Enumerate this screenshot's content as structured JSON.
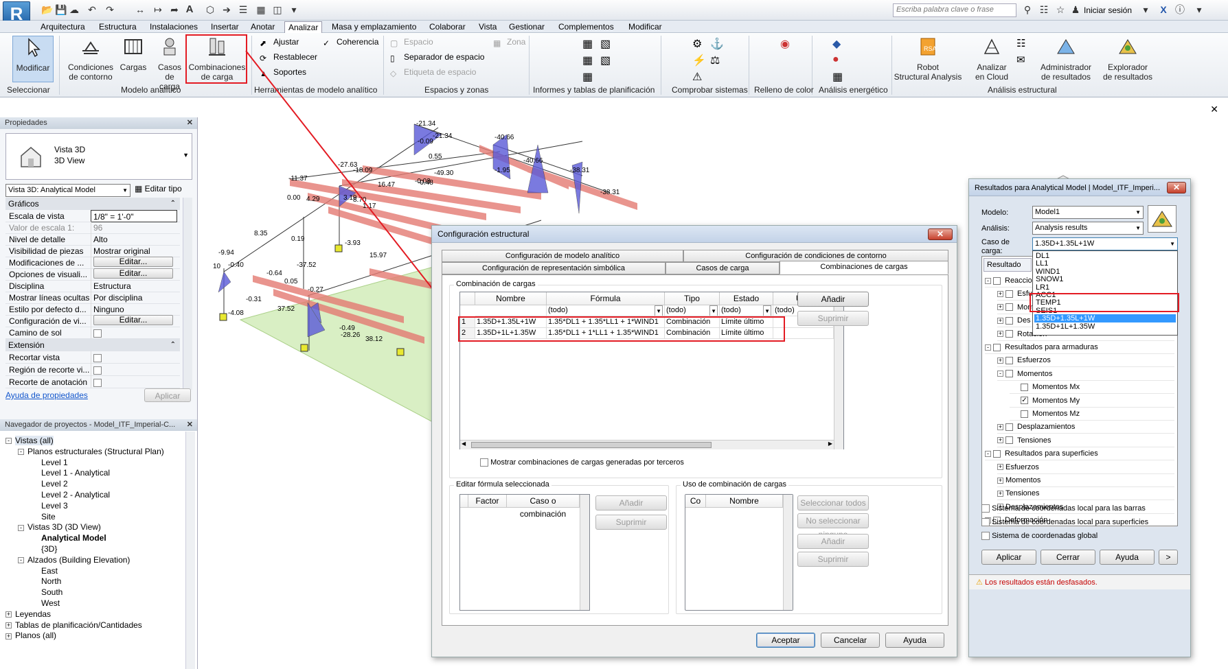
{
  "app": {
    "logo": "R",
    "search_placeholder": "Escriba palabra clave o frase",
    "signin": "Iniciar sesión"
  },
  "tabs": [
    "Arquitectura",
    "Estructura",
    "Instalaciones",
    "Insertar",
    "Anotar",
    "Analizar",
    "Masa y emplazamiento",
    "Colaborar",
    "Vista",
    "Gestionar",
    "Complementos",
    "Modificar"
  ],
  "ribbon": {
    "modify": "Modificar",
    "boundary": [
      "Condiciones",
      "de contorno"
    ],
    "loads": "Cargas",
    "load_cases": [
      "Casos",
      "de carga"
    ],
    "load_combos": [
      "Combinaciones",
      "de carga"
    ],
    "adjust": "Ajustar",
    "reset": "Restablecer",
    "supports": "Soportes",
    "consistency": "Coherencia",
    "space": "Espacio",
    "zone": "Zona",
    "space_sep": "Separador de espacio",
    "space_tag": "Etiqueta de espacio",
    "robot": [
      "Robot",
      "Structural Analysis"
    ],
    "cloud": [
      "Analizar",
      "en Cloud"
    ],
    "results_mgr": [
      "Administrador",
      "de resultados"
    ],
    "results_exp": [
      "Explorador",
      "de resultados"
    ],
    "groups": [
      "Seleccionar",
      "Modelo analítico",
      "Herramientas de modelo analítico",
      "Espacios y zonas",
      "Informes y tablas de planificación",
      "Comprobar sistemas",
      "Relleno de color",
      "Análisis energético",
      "Análisis estructural"
    ]
  },
  "properties": {
    "title": "Propiedades",
    "type_name": "Vista 3D",
    "type_sub": "3D View",
    "selector": "Vista 3D: Analytical Model",
    "edit_type": "Editar tipo",
    "sec_graphics": "Gráficos",
    "rows": [
      {
        "k": "Escala de vista",
        "v": "1/8\" = 1'-0\""
      },
      {
        "k": "Valor de escala    1:",
        "v": "96"
      },
      {
        "k": "Nivel de detalle",
        "v": "Alto"
      },
      {
        "k": "Visibilidad de piezas",
        "v": "Mostrar original"
      },
      {
        "k": "Modificaciones de ...",
        "v": "Editar..."
      },
      {
        "k": "Opciones de visuali...",
        "v": "Editar..."
      },
      {
        "k": "Disciplina",
        "v": "Estructura"
      },
      {
        "k": "Mostrar líneas ocultas",
        "v": "Por disciplina"
      },
      {
        "k": "Estilo por defecto d...",
        "v": "Ninguno"
      },
      {
        "k": "Configuración de vi...",
        "v": "Editar..."
      },
      {
        "k": "Camino de sol",
        "v": ""
      }
    ],
    "sec_extent": "Extensión",
    "extent_rows": [
      "Recortar vista",
      "Región de recorte vi...",
      "Recorte de anotación"
    ],
    "help_link": "Ayuda de propiedades",
    "apply": "Aplicar"
  },
  "browser": {
    "title": "Navegador de proyectos - Model_ITF_Imperial-C...",
    "items": [
      "Vistas (all)",
      "Planos estructurales (Structural Plan)",
      "Level 1",
      "Level 1 - Analytical",
      "Level 2",
      "Level 2 - Analytical",
      "Level 3",
      "Site",
      "Vistas 3D (3D View)",
      "Analytical Model",
      "{3D}",
      "Alzados (Building Elevation)",
      "East",
      "North",
      "South",
      "West",
      "Leyendas",
      "Tablas de planificación/Cantidades",
      "Planos (all)"
    ]
  },
  "diagram_labels": [
    "-21.34",
    "-21.34",
    "-0.09",
    "-40.66",
    "-40.66",
    "0.55",
    "-27.63",
    "-18.09",
    "-1.95",
    "-38.31",
    "-11.37",
    "-49.30",
    "-0.48",
    "-0.03",
    "16.47",
    "-38.31",
    "0.00",
    "4.29",
    "3.19",
    "8.70",
    "1.17",
    "8.35",
    "0.19",
    "-3.93",
    "15.97",
    "-9.94",
    "-0.40",
    "-37.52",
    "-0.64",
    "0.05",
    "-0.27",
    "-0.31",
    "37.52",
    "-4.08",
    "-0.49",
    "-28.26",
    "38.12",
    "10",
    "0.8"
  ],
  "config_dialog": {
    "title": "Configuración estructural",
    "tabs_row1": [
      "Configuración de modelo analítico",
      "Configuración de condiciones de contorno"
    ],
    "tabs_row2": [
      "Configuración de representación simbólica",
      "Casos de carga",
      "Combinaciones de cargas"
    ],
    "group_title": "Combinación de cargas",
    "columns": [
      "Nombre",
      "Fórmula",
      "Tipo",
      "Estado",
      "Uso"
    ],
    "filters": [
      "(todo)",
      "(todo)",
      "(todo)",
      "(todo)"
    ],
    "rows": [
      {
        "n": "1",
        "name": "1.35D+1.35L+1W",
        "formula": "1.35*DL1 + 1.35*LL1 + 1*WIND1",
        "type": "Combinación",
        "state": "Límite último",
        "use": ""
      },
      {
        "n": "2",
        "name": "1.35D+1L+1.35W",
        "formula": "1.35*DL1 + 1*LL1 + 1.35*WIND1",
        "type": "Combinación",
        "state": "Límite último",
        "use": ""
      }
    ],
    "add": "Añadir",
    "delete": "Suprimir",
    "third_party": "Mostrar combinaciones de cargas generadas por terceros",
    "edit_formula": "Editar fórmula seleccionada",
    "ef_cols": [
      "Factor",
      "Caso o combinación"
    ],
    "usage_title": "Uso de combinación de cargas",
    "usage_cols": [
      "Co",
      "Nombre"
    ],
    "select_all": "Seleccionar todos",
    "select_none": "No seleccionar ninguno",
    "ok": "Aceptar",
    "cancel": "Cancelar",
    "help": "Ayuda"
  },
  "results_dialog": {
    "title": "Resultados para Analytical Model | Model_ITF_Imperi...",
    "model_label": "Modelo:",
    "model": "Model1",
    "analysis_label": "Análisis:",
    "analysis": "Analysis results",
    "case_label": [
      "Caso de",
      "carga:"
    ],
    "case": "1.35D+1.35L+1W",
    "case_options": [
      "DL1",
      "LL1",
      "WIND1",
      "SNOW1",
      "LR1",
      "ACC1",
      "TEMP1",
      "SEIS1",
      "1.35D+1.35L+1W",
      "1.35D+1L+1.35W"
    ],
    "result_tab": "Resultado",
    "tree": [
      {
        "lvl": 0,
        "t": "-",
        "c": false,
        "label": "Reaccio"
      },
      {
        "lvl": 1,
        "t": "+",
        "c": false,
        "label": "Esfu"
      },
      {
        "lvl": 1,
        "t": "+",
        "c": false,
        "label": "Mom"
      },
      {
        "lvl": 1,
        "t": "+",
        "c": false,
        "label": "Des"
      },
      {
        "lvl": 1,
        "t": "+",
        "c": false,
        "label": "Rotación"
      },
      {
        "lvl": 0,
        "t": "-",
        "c": false,
        "label": "Resultados para armaduras"
      },
      {
        "lvl": 1,
        "t": "+",
        "c": false,
        "label": "Esfuerzos"
      },
      {
        "lvl": 1,
        "t": "-",
        "c": false,
        "label": "Momentos"
      },
      {
        "lvl": 2,
        "t": "",
        "c": false,
        "label": "Momentos Mx"
      },
      {
        "lvl": 2,
        "t": "",
        "c": true,
        "label": "Momentos My"
      },
      {
        "lvl": 2,
        "t": "",
        "c": false,
        "label": "Momentos Mz"
      },
      {
        "lvl": 1,
        "t": "+",
        "c": false,
        "label": "Desplazamientos"
      },
      {
        "lvl": 1,
        "t": "+",
        "c": false,
        "label": "Tensiones"
      },
      {
        "lvl": 0,
        "t": "-",
        "c": false,
        "label": "Resultados para superficies"
      },
      {
        "lvl": 1,
        "t": "+",
        "c": null,
        "label": "Esfuerzos"
      },
      {
        "lvl": 1,
        "t": "+",
        "c": null,
        "label": "Momentos"
      },
      {
        "lvl": 1,
        "t": "+",
        "c": null,
        "label": "Tensiones"
      },
      {
        "lvl": 1,
        "t": "+",
        "c": null,
        "label": "Desplazamientos"
      },
      {
        "lvl": 0,
        "t": "+",
        "c": false,
        "label": "Deformación"
      }
    ],
    "checks": [
      "Sistema de coordenadas local para las barras",
      "Sistema de coordenadas local para superficies",
      "Sistema de coordenadas global"
    ],
    "apply": "Aplicar",
    "cancel": "Cerrar",
    "help": "Ayuda",
    "more": ">",
    "warning": "Los resultados están desfasados."
  }
}
